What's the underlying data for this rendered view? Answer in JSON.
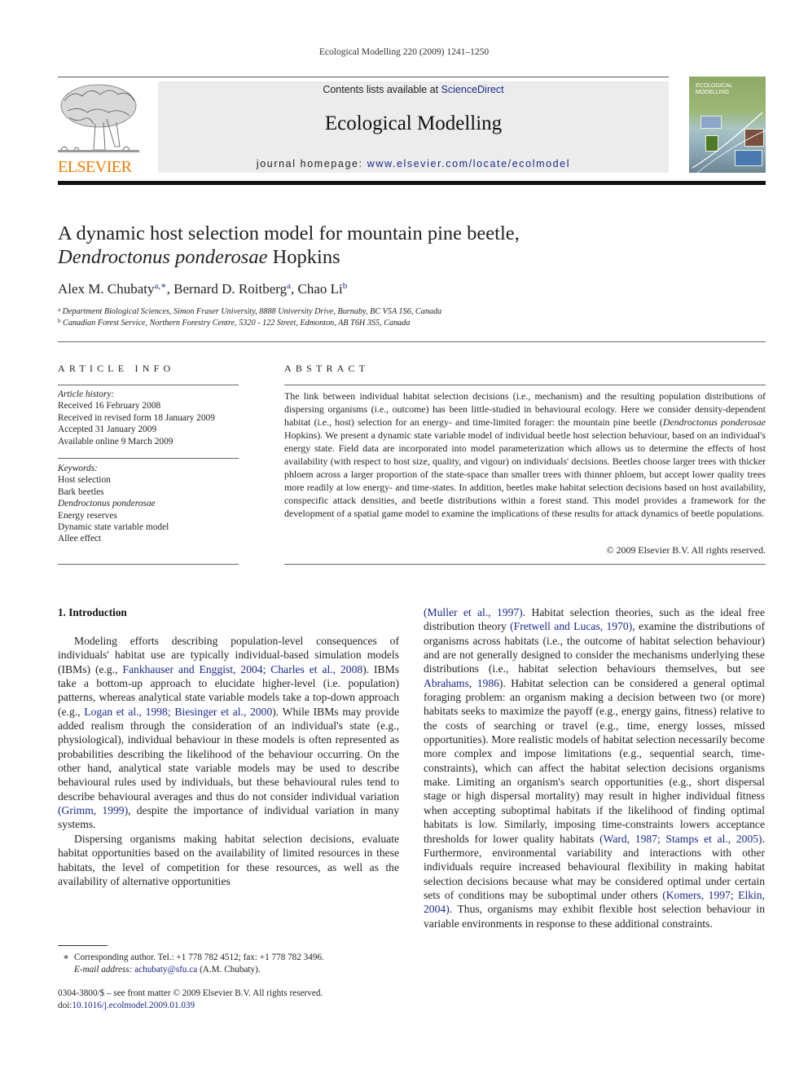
{
  "running_head": "Ecological Modelling 220 (2009) 1241–1250",
  "masthead": {
    "publisher_wordmark": "ELSEVIER",
    "contents_prefix": "Contents lists available at ",
    "contents_link": "ScienceDirect",
    "journal_name": "Ecological Modelling",
    "homepage_prefix": "journal homepage: ",
    "homepage_link": "www.elsevier.com/locate/ecolmodel",
    "cover_title_line1": "ECOLOGICAL",
    "cover_title_line2": "MODELLING",
    "publisher_logo_icon": "elsevier-tree-logo",
    "cover_icon": "journal-cover-thumbnail"
  },
  "article": {
    "title_line1": "A dynamic host selection model for mountain pine beetle,",
    "title_species": "Dendroctonus ponderosae",
    "title_authority": " Hopkins",
    "authors": [
      {
        "name": "Alex M. Chubaty",
        "sup": "a,∗",
        "sep": ", "
      },
      {
        "name": "Bernard D. Roitberg",
        "sup": "a",
        "sep": ", "
      },
      {
        "name": "Chao Li",
        "sup": "b",
        "sep": ""
      }
    ],
    "affiliations": [
      {
        "mark": "a",
        "text": "Department Biological Sciences, Simon Fraser University, 8888 University Drive, Burnaby, BC V5A 1S6, Canada"
      },
      {
        "mark": "b",
        "text": "Canadian Forest Service, Northern Forestry Centre, 5320 - 122 Street, Edmonton, AB T6H 3S5, Canada"
      }
    ]
  },
  "article_info": {
    "heading": "ARTICLE INFO",
    "history_label": "Article history:",
    "history": [
      "Received 16 February 2008",
      "Received in revised form 18 January 2009",
      "Accepted 31 January 2009",
      "Available online 9 March 2009"
    ],
    "keywords_label": "Keywords:",
    "keywords": [
      {
        "text": "Host selection",
        "italic": false
      },
      {
        "text": "Bark beetles",
        "italic": false
      },
      {
        "text": "Dendroctonus ponderosae",
        "italic": true
      },
      {
        "text": "Energy reserves",
        "italic": false
      },
      {
        "text": "Dynamic state variable model",
        "italic": false
      },
      {
        "text": "Allee effect",
        "italic": false
      }
    ]
  },
  "abstract": {
    "heading": "ABSTRACT",
    "part1": "The link between individual habitat selection decisions (i.e., mechanism) and the resulting population distributions of dispersing organisms (i.e., outcome) has been little-studied in behavioural ecology. Here we consider density-dependent habitat (i.e., host) selection for an energy- and time-limited forager: the mountain pine beetle (",
    "species": "Dendroctonus ponderosae",
    "part2": " Hopkins). We present a dynamic state variable model of individual beetle host selection behaviour, based on an individual's energy state. Field data are incorporated into model parameterization which allows us to determine the effects of host availability (with respect to host size, quality, and vigour) on individuals' decisions. Beetles choose larger trees with thicker phloem across a larger proportion of the state-space than smaller trees with thinner phloem, but accept lower quality trees more readily at low energy- and time-states. In addition, beetles make habitat selection decisions based on host availability, conspecific attack densities, and beetle distributions within a forest stand. This model provides a framework for the development of a spatial game model to examine the implications of these results for attack dynamics of beetle populations.",
    "copyright": "© 2009 Elsevier B.V. All rights reserved."
  },
  "introduction": {
    "heading": "1.  Introduction",
    "left_p1": [
      {
        "t": "Modeling efforts describing population-level consequences of individuals' habitat use are typically individual-based simulation models (IBMs) (e.g., "
      },
      {
        "t": "Fankhauser and Enggist, 2004; Charles et al., 2008",
        "link": true
      },
      {
        "t": "). IBMs take a bottom-up approach to elucidate higher-level (i.e. population) patterns, whereas analytical state variable models take a top-down approach (e.g., "
      },
      {
        "t": "Logan et al., 1998; Biesinger et al., 2000",
        "link": true
      },
      {
        "t": "). While IBMs may provide added realism through the consideration of an individual's state (e.g., physiological), individual behaviour in these models is often represented as probabilities describing the likelihood of the behaviour occurring. On the other hand, analytical state variable models may be used to describe behavioural rules used by individuals, but these behavioural rules tend to describe behavioural averages and thus do not consider individual variation "
      },
      {
        "t": "(Grimm, 1999)",
        "link": true
      },
      {
        "t": ", despite the importance of individual variation in many systems."
      }
    ],
    "left_p2": [
      {
        "t": "Dispersing organisms making habitat selection decisions, evaluate habitat opportunities based on the availability of limited resources in these habitats, the level of competition for these resources, as well as the availability of alternative opportunities"
      }
    ],
    "right_p1": [
      {
        "t": "(Muller et al., 1997)",
        "link": true
      },
      {
        "t": ". Habitat selection theories, such as the ideal free distribution theory "
      },
      {
        "t": "(Fretwell and Lucas, 1970)",
        "link": true
      },
      {
        "t": ", examine the distributions of organisms across habitats (i.e., the outcome of habitat selection behaviour) and are not generally designed to consider the mechanisms underlying these distributions (i.e., habitat selection behaviours themselves, but see "
      },
      {
        "t": "Abrahams, 1986",
        "link": true
      },
      {
        "t": "). Habitat selection can be considered a general optimal foraging problem: an organism making a decision between two (or more) habitats seeks to maximize the payoff (e.g., energy gains, fitness) relative to the costs of searching or travel (e.g., time, energy losses, missed opportunities). More realistic models of habitat selection necessarily become more complex and impose limitations (e.g., sequential search, time-constraints), which can affect the habitat selection decisions organisms make. Limiting an organism's search opportunities (e.g., short dispersal stage or high dispersal mortality) may result in higher individual fitness when accepting suboptimal habitats if the likelihood of finding optimal habitats is low. Similarly, imposing time-constraints lowers acceptance thresholds for lower quality habitats "
      },
      {
        "t": "(Ward, 1987; Stamps et al., 2005)",
        "link": true
      },
      {
        "t": ". Furthermore, environmental variability and interactions with other individuals require increased behavioural flexibility in making habitat selection decisions because what may be considered optimal under certain sets of conditions may be suboptimal under others "
      },
      {
        "t": "(Komers, 1997; Elkin, 2004)",
        "link": true
      },
      {
        "t": ". Thus, organisms may exhibit flexible host selection behaviour in variable environments in response to these additional constraints."
      }
    ]
  },
  "footnotes": {
    "mark": "∗",
    "corresponding": "Corresponding author. Tel.: +1 778 782 4512; fax: +1 778 782 3496.",
    "email_label": "E-mail address:",
    "email": "achubaty@sfu.ca",
    "email_suffix": " (A.M. Chubaty).",
    "issn_line": "0304-3800/$ – see front matter © 2009 Elsevier B.V. All rights reserved.",
    "doi_prefix": "doi:",
    "doi": "10.1016/j.ecolmodel.2009.01.039"
  },
  "colors": {
    "link": "#1a2a8a",
    "elsevier_orange": "#f07c00",
    "masthead_bg": "#ececec"
  }
}
